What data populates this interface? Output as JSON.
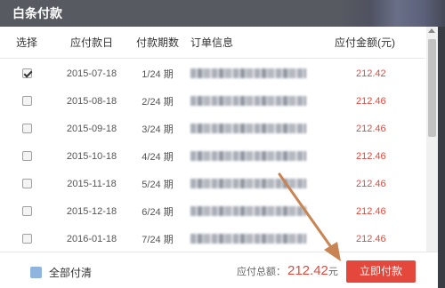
{
  "dialog": {
    "title": "白条付款"
  },
  "table": {
    "headers": {
      "select": "选择",
      "due_date": "应付款日",
      "term": "付款期数",
      "order": "订单信息",
      "amount": "应付金额(元)"
    },
    "rows": [
      {
        "checked": true,
        "due_date": "2015-07-18",
        "term": "1/24 期",
        "amount": "212.42"
      },
      {
        "checked": false,
        "due_date": "2015-08-18",
        "term": "2/24 期",
        "amount": "212.46"
      },
      {
        "checked": false,
        "due_date": "2015-09-18",
        "term": "3/24 期",
        "amount": "212.46"
      },
      {
        "checked": false,
        "due_date": "2015-10-18",
        "term": "4/24 期",
        "amount": "212.46"
      },
      {
        "checked": false,
        "due_date": "2015-11-18",
        "term": "5/24 期",
        "amount": "212.46"
      },
      {
        "checked": false,
        "due_date": "2015-12-18",
        "term": "6/24 期",
        "amount": "212.46"
      },
      {
        "checked": false,
        "due_date": "2016-01-18",
        "term": "7/24 期",
        "amount": "212.46"
      }
    ]
  },
  "footer": {
    "pay_all_label": "全部付清",
    "total_label": "应付总额：",
    "total_amount": "212.42",
    "total_unit": "元",
    "pay_button": "立即付款"
  },
  "colors": {
    "accent": "#e4473c",
    "amount_text": "#e04a3f",
    "titlebar": "#585a61",
    "annotation_arrow": "#c98453"
  }
}
